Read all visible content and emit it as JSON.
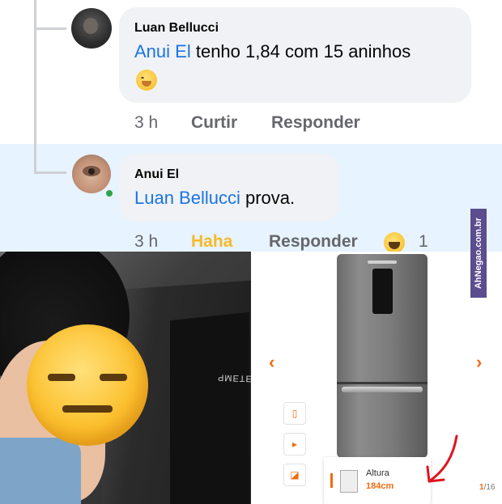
{
  "comment1": {
    "author": "Luan Bellucci",
    "mention": "Anui El",
    "text": "tenho 1,84 com 15 aninhos",
    "emoji": "smiling-face-with-hand-over-mouth",
    "time": "3 h",
    "like_label": "Curtir",
    "reply_label": "Responder"
  },
  "comment2": {
    "author": "Anui El",
    "mention": "Luan Bellucci",
    "text": "prova.",
    "time": "3 h",
    "reaction_label": "Haha",
    "reply_label": "Responder",
    "reaction_count": "1",
    "reaction_emoji": "laughing-face"
  },
  "product": {
    "spec_label": "Altura",
    "spec_value": "184cm",
    "page_current": "1",
    "page_total": "/16",
    "brand_strip_text": "ƎTƎMP"
  },
  "watermark": "AhNegao.com.br",
  "colors": {
    "mention_blue": "#1b74e4",
    "haha_yellow": "#f7b928",
    "accent_orange": "#f26b0f",
    "highlight_bg": "#e7f3ff"
  }
}
